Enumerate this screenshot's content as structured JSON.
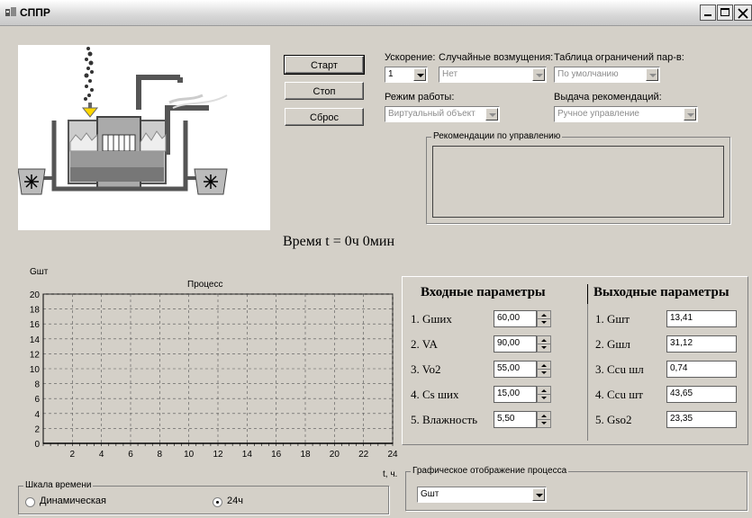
{
  "window": {
    "title": "СППР"
  },
  "buttons": {
    "start": "Старт",
    "stop": "Стоп",
    "reset": "Сброс"
  },
  "controls": {
    "acceleration": {
      "label": "Ускорение:",
      "value": "1"
    },
    "disturbances": {
      "label": "Случайные возмущения:",
      "value": "Нет"
    },
    "constraints": {
      "label": "Таблица ограничений пар-в:",
      "value": "По умолчанию"
    },
    "mode": {
      "label": "Режим работы:",
      "value": "Виртуальный объект"
    },
    "recommendation_output": {
      "label": "Выдача рекомендаций:",
      "value": "Ручное управление"
    },
    "recommendations_group": {
      "label": "Рекомендации по управлению",
      "text": ""
    }
  },
  "time_display": "Время t = 0ч 0мин",
  "chart_data": {
    "type": "line",
    "title": "Процесс",
    "ylabel": "Gшт",
    "xlabel": "t, ч.",
    "xlim": [
      0,
      24
    ],
    "ylim": [
      0,
      20
    ],
    "x_ticks": [
      "2",
      "4",
      "6",
      "8",
      "10",
      "12",
      "14",
      "16",
      "18",
      "20",
      "22",
      "24"
    ],
    "y_ticks": [
      "0",
      "2",
      "4",
      "6",
      "8",
      "10",
      "12",
      "14",
      "16",
      "18",
      "20"
    ],
    "grid": true,
    "series": []
  },
  "input_params": {
    "title": "Входные параметры",
    "items": [
      {
        "label": "1. Gших",
        "value": "60,00"
      },
      {
        "label": "2. VA",
        "value": "90,00"
      },
      {
        "label": "3. Vo2",
        "value": "55,00"
      },
      {
        "label": "4. Cs ших",
        "value": "15,00"
      },
      {
        "label": "5. Влажность",
        "value": "5,50"
      }
    ]
  },
  "output_params": {
    "title": "Выходные параметры",
    "items": [
      {
        "label": "1. Gшт",
        "value": "13,41"
      },
      {
        "label": "2. Gшл",
        "value": "31,12"
      },
      {
        "label": "3. Ccu шл",
        "value": "0,74"
      },
      {
        "label": "4. Ccu шт",
        "value": "43,65"
      },
      {
        "label": "5. Gso2",
        "value": "23,35"
      }
    ]
  },
  "time_scale": {
    "label": "Шкала времени",
    "dynamic": "Динамическая",
    "fixed": "24ч",
    "selected": "24ч"
  },
  "graphic_display": {
    "label": "Графическое отображение процесса",
    "value": "Gшт"
  }
}
